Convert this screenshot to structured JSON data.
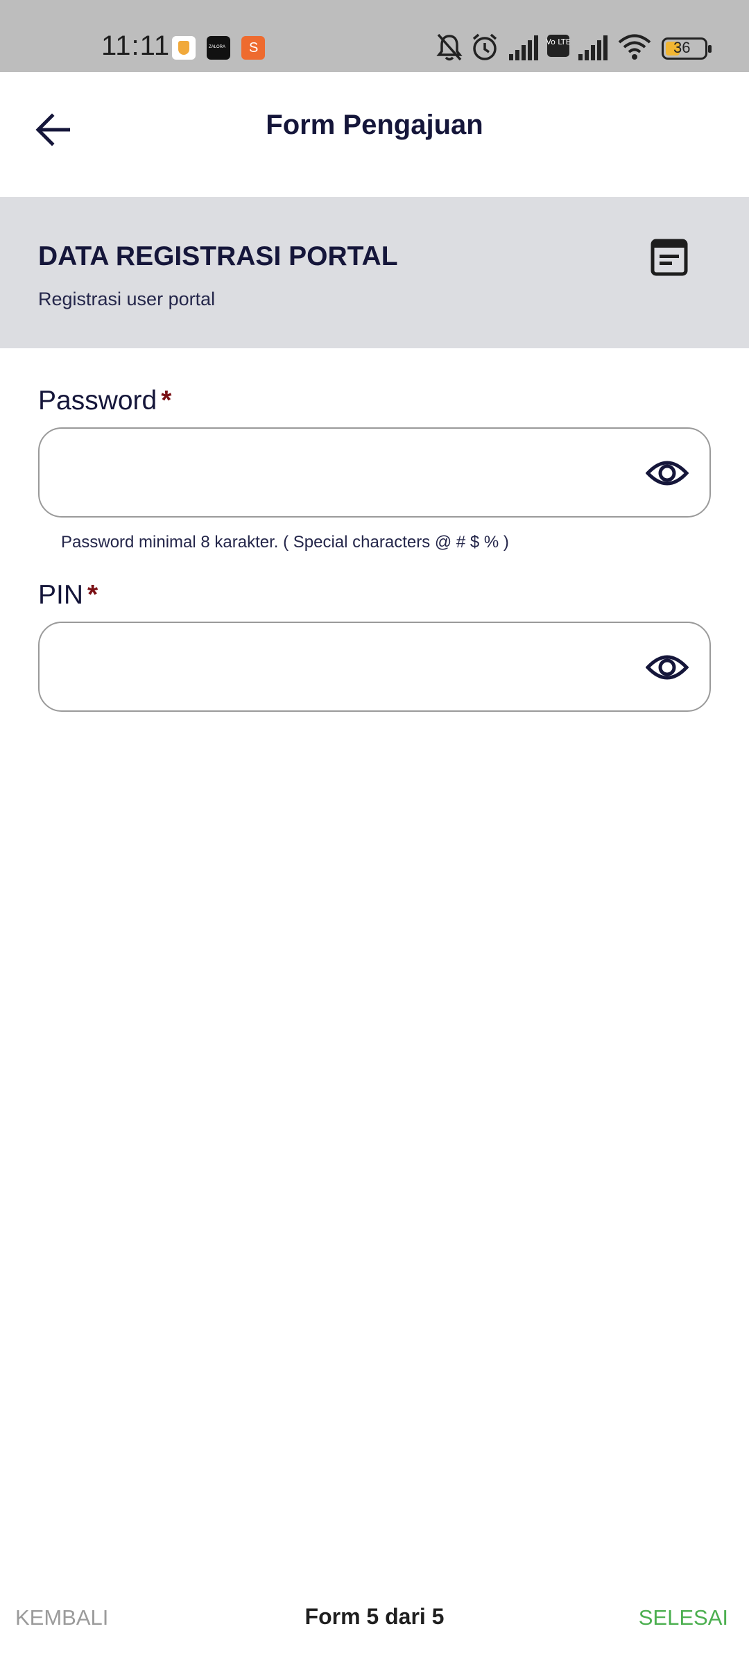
{
  "status_bar": {
    "time": "11:11",
    "battery_level": "36",
    "network_badge": "Vo LTE",
    "notification_icons": [
      "shield-app-icon",
      "zalora-app-icon",
      "shopee-app-icon"
    ],
    "system_icons": [
      "bell-muted-icon",
      "alarm-icon",
      "signal-icon",
      "volte-icon",
      "signal-icon",
      "wifi-icon",
      "battery-icon"
    ]
  },
  "header": {
    "title": "Form Pengajuan",
    "back_icon": "arrow-left-icon"
  },
  "section": {
    "title": "DATA REGISTRASI PORTAL",
    "subtitle": "Registrasi user portal",
    "icon": "document-icon"
  },
  "form": {
    "password": {
      "label": "Password",
      "required_mark": "*",
      "value": "",
      "hint": "Password minimal 8 karakter. ( Special characters @ # $ % )",
      "toggle_icon": "eye-icon"
    },
    "pin": {
      "label": "PIN",
      "required_mark": "*",
      "value": "",
      "toggle_icon": "eye-icon"
    }
  },
  "footer": {
    "back_label": "KEMBALI",
    "step_text": "Form 5 dari 5",
    "finish_label": "SELESAI"
  },
  "colors": {
    "primary_text": "#15163a",
    "required": "#7a0f14",
    "finish": "#4caf50",
    "disabled": "#9b9b9b",
    "section_bg": "#dcdde1",
    "status_bar_bg": "#bdbdbd"
  }
}
